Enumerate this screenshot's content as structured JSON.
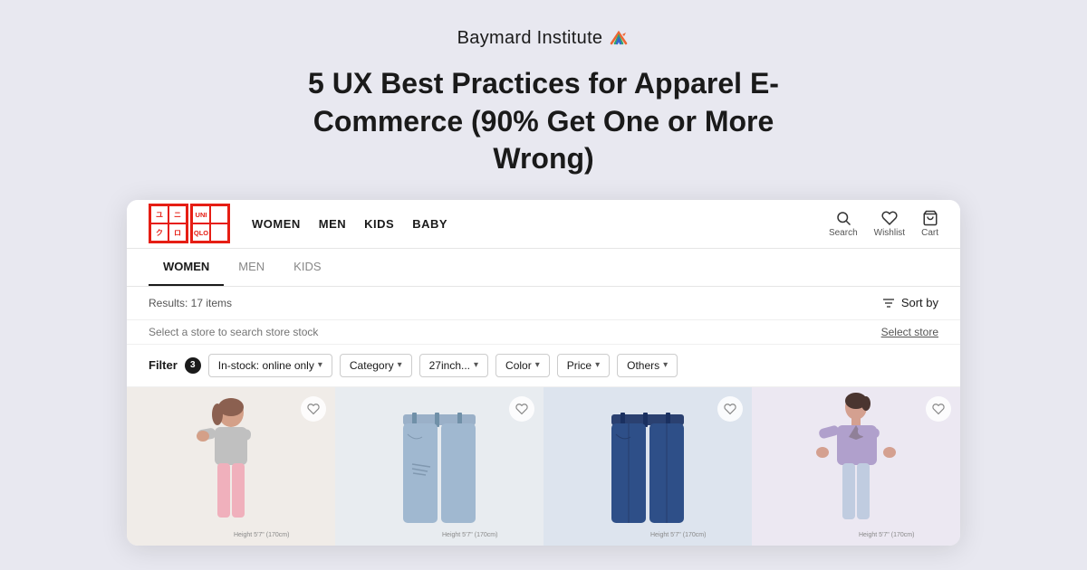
{
  "brand": {
    "name": "Baymard Institute"
  },
  "title": "5 UX Best Practices for Apparel E-Commerce (90% Get One or More Wrong)",
  "uniqlo": {
    "logo_cells": [
      "ユ",
      "ニ",
      "ク",
      "ロ"
    ],
    "logo_text": "UNI\nQLO",
    "nav_items": [
      "WOMEN",
      "MEN",
      "KIDS",
      "BABY"
    ],
    "header_icons": [
      {
        "icon": "search",
        "label": "Search"
      },
      {
        "icon": "heart",
        "label": "Wishlist"
      },
      {
        "icon": "cart",
        "label": "Cart"
      }
    ],
    "sub_nav": [
      {
        "label": "WOMEN",
        "active": true
      },
      {
        "label": "MEN",
        "active": false
      },
      {
        "label": "KIDS",
        "active": false
      }
    ],
    "results_label": "Results: 17 items",
    "sort_label": "Sort by",
    "store_placeholder": "Select a store to search store stock",
    "select_store_label": "Select store",
    "filter_label": "Filter",
    "filter_count": "3",
    "filter_chips": [
      {
        "label": "In-stock: online only",
        "has_dropdown": true
      },
      {
        "label": "Category",
        "has_dropdown": true
      },
      {
        "label": "27inch...",
        "has_dropdown": true
      },
      {
        "label": "Color",
        "has_dropdown": true
      },
      {
        "label": "Price",
        "has_dropdown": true
      },
      {
        "label": "Others",
        "has_dropdown": true
      }
    ],
    "products": [
      {
        "id": 1,
        "bg": "#f2ece6",
        "figure_color": "#e8b4a0",
        "pants_color": "#f0c0c8",
        "style": "casual"
      },
      {
        "id": 2,
        "bg": "#eaeef5",
        "figure_color": "#c8b49a",
        "pants_color": "#a8b8d0",
        "style": "jeans_ripped"
      },
      {
        "id": 3,
        "bg": "#dde6ef",
        "figure_color": "#c8b49a",
        "pants_color": "#3a5a8a",
        "style": "jeans_dark"
      },
      {
        "id": 4,
        "bg": "#ece9f2",
        "figure_color": "#c8a09a",
        "pants_color": "#c0c8e0",
        "style": "jacket"
      }
    ]
  }
}
